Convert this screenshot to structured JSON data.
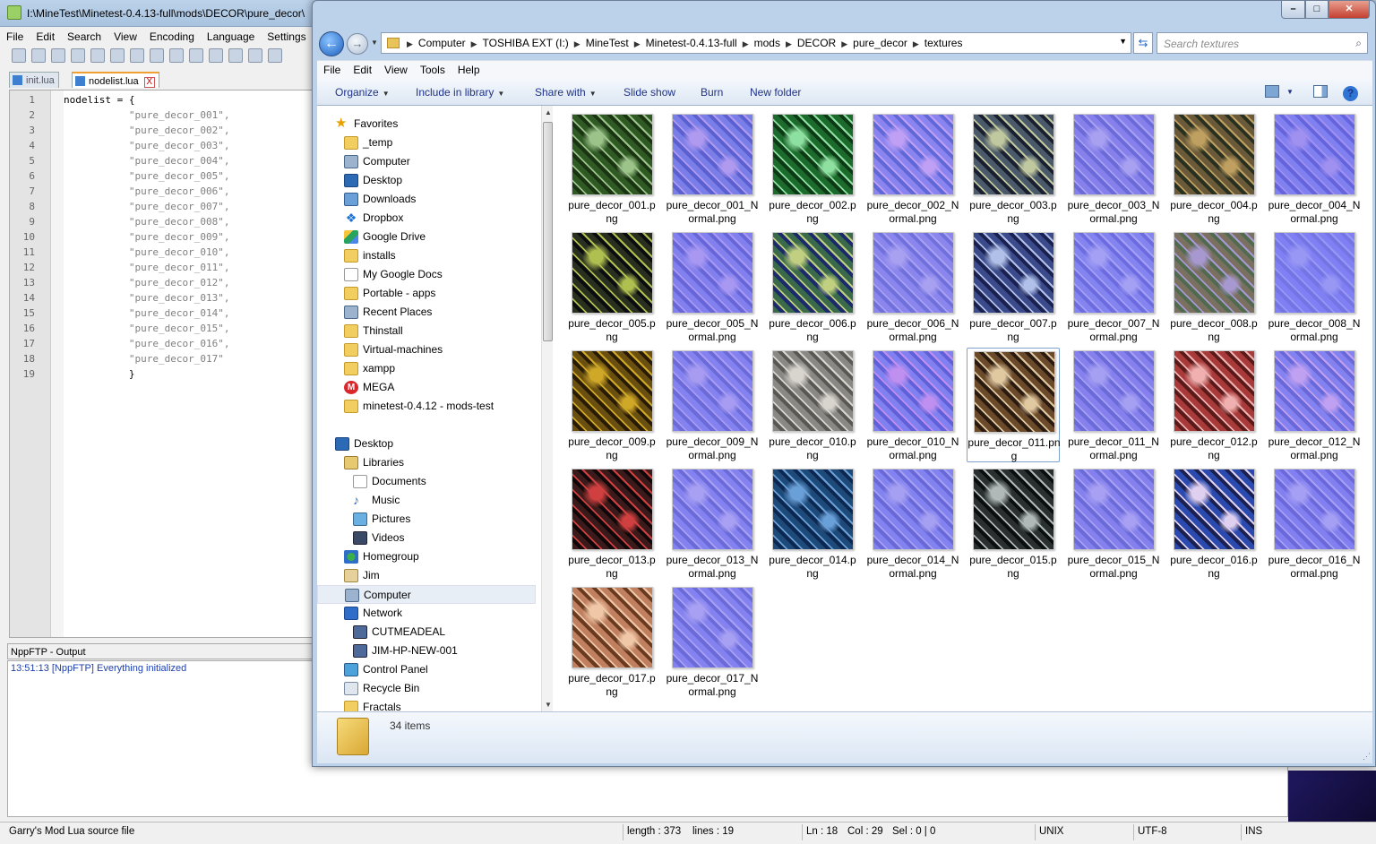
{
  "npp": {
    "title": "I:\\MineTest\\Minetest-0.4.13-full\\mods\\DECOR\\pure_decor\\",
    "menu": [
      "File",
      "Edit",
      "Search",
      "View",
      "Encoding",
      "Language",
      "Settings"
    ],
    "tabs": [
      {
        "label": "init.lua",
        "active": false
      },
      {
        "label": "nodelist.lua",
        "active": true,
        "close": "X"
      }
    ],
    "lines": [
      {
        "n": "1",
        "indent": "",
        "text": "nodelist = {"
      },
      {
        "n": "2",
        "indent": "           ",
        "text": "\"pure_decor_001\","
      },
      {
        "n": "3",
        "indent": "           ",
        "text": "\"pure_decor_002\","
      },
      {
        "n": "4",
        "indent": "           ",
        "text": "\"pure_decor_003\","
      },
      {
        "n": "5",
        "indent": "           ",
        "text": "\"pure_decor_004\","
      },
      {
        "n": "6",
        "indent": "           ",
        "text": "\"pure_decor_005\","
      },
      {
        "n": "7",
        "indent": "           ",
        "text": "\"pure_decor_006\","
      },
      {
        "n": "8",
        "indent": "           ",
        "text": "\"pure_decor_007\","
      },
      {
        "n": "9",
        "indent": "           ",
        "text": "\"pure_decor_008\","
      },
      {
        "n": "10",
        "indent": "           ",
        "text": "\"pure_decor_009\","
      },
      {
        "n": "11",
        "indent": "           ",
        "text": "\"pure_decor_010\","
      },
      {
        "n": "12",
        "indent": "           ",
        "text": "\"pure_decor_011\","
      },
      {
        "n": "13",
        "indent": "           ",
        "text": "\"pure_decor_012\","
      },
      {
        "n": "14",
        "indent": "           ",
        "text": "\"pure_decor_013\","
      },
      {
        "n": "15",
        "indent": "           ",
        "text": "\"pure_decor_014\","
      },
      {
        "n": "16",
        "indent": "           ",
        "text": "\"pure_decor_015\","
      },
      {
        "n": "17",
        "indent": "           ",
        "text": "\"pure_decor_016\","
      },
      {
        "n": "18",
        "indent": "           ",
        "text": "\"pure_decor_017\""
      },
      {
        "n": "19",
        "indent": "           ",
        "text": "}"
      }
    ],
    "output_title": "NppFTP - Output",
    "output_line": "13:51:13  [NppFTP] Everything initialized",
    "status": {
      "filetype": "Garry's Mod Lua source file",
      "length": "length : 373",
      "lines": "lines : 19",
      "ln": "Ln : 18",
      "col": "Col : 29",
      "sel": "Sel : 0 | 0",
      "eol": "UNIX",
      "enc": "UTF-8",
      "mode": "INS"
    }
  },
  "explorer": {
    "breadcrumbs": [
      "Computer",
      "TOSHIBA EXT (I:)",
      "MineTest",
      "Minetest-0.4.13-full",
      "mods",
      "DECOR",
      "pure_decor",
      "textures"
    ],
    "search_placeholder": "Search textures",
    "menu": [
      "File",
      "Edit",
      "View",
      "Tools",
      "Help"
    ],
    "commands": {
      "organize": "Organize",
      "include": "Include in library",
      "share": "Share with",
      "slideshow": "Slide show",
      "burn": "Burn",
      "newfolder": "New folder"
    },
    "nav": [
      {
        "label": "Favorites",
        "icon": "star",
        "indent": 0
      },
      {
        "label": "_temp",
        "icon": "folder",
        "indent": 1
      },
      {
        "label": "Computer",
        "icon": "comp",
        "indent": 1
      },
      {
        "label": "Desktop",
        "icon": "desk",
        "indent": 1
      },
      {
        "label": "Downloads",
        "icon": "dl",
        "indent": 1
      },
      {
        "label": "Dropbox",
        "icon": "dbx",
        "indent": 1
      },
      {
        "label": "Google Drive",
        "icon": "gd",
        "indent": 1
      },
      {
        "label": "installs",
        "icon": "folder",
        "indent": 1
      },
      {
        "label": "My Google Docs",
        "icon": "doc",
        "indent": 1
      },
      {
        "label": "Portable - apps",
        "icon": "folder",
        "indent": 1
      },
      {
        "label": "Recent Places",
        "icon": "comp",
        "indent": 1
      },
      {
        "label": "Thinstall",
        "icon": "folder",
        "indent": 1
      },
      {
        "label": "Virtual-machines",
        "icon": "folder",
        "indent": 1
      },
      {
        "label": "xampp",
        "icon": "folder",
        "indent": 1
      },
      {
        "label": "MEGA",
        "icon": "mega",
        "indent": 1
      },
      {
        "label": "minetest-0.4.12 - mods-test",
        "icon": "folder",
        "indent": 1
      },
      {
        "label": "",
        "icon": "",
        "indent": 0
      },
      {
        "label": "Desktop",
        "icon": "desk",
        "indent": 0
      },
      {
        "label": "Libraries",
        "icon": "lib",
        "indent": 1
      },
      {
        "label": "Documents",
        "icon": "doc",
        "indent": 2
      },
      {
        "label": "Music",
        "icon": "music",
        "indent": 2
      },
      {
        "label": "Pictures",
        "icon": "pic",
        "indent": 2
      },
      {
        "label": "Videos",
        "icon": "vid",
        "indent": 2
      },
      {
        "label": "Homegroup",
        "icon": "home",
        "indent": 1
      },
      {
        "label": "Jim",
        "icon": "user",
        "indent": 1
      },
      {
        "label": "Computer",
        "icon": "comp",
        "indent": 1,
        "selected": true
      },
      {
        "label": "Network",
        "icon": "net",
        "indent": 1
      },
      {
        "label": "CUTMEADEAL",
        "icon": "pc",
        "indent": 2
      },
      {
        "label": "JIM-HP-NEW-001",
        "icon": "pc",
        "indent": 2
      },
      {
        "label": "Control Panel",
        "icon": "cp",
        "indent": 1
      },
      {
        "label": "Recycle Bin",
        "icon": "bin",
        "indent": 1
      },
      {
        "label": "Fractals",
        "icon": "folder",
        "indent": 1
      }
    ],
    "files": [
      {
        "name": "pure_decor_001.png",
        "tex": [
          "#2f5a24",
          "#9cc48a",
          "#1a3312"
        ]
      },
      {
        "name": "pure_decor_001_Normal.png",
        "tex": [
          "#7a7ee8",
          "#b09af0",
          "#5a60d0"
        ]
      },
      {
        "name": "pure_decor_002.png",
        "tex": [
          "#1c6a2c",
          "#8ee0a0",
          "#0c3a16"
        ]
      },
      {
        "name": "pure_decor_002_Normal.png",
        "tex": [
          "#8a84f0",
          "#c0a0f4",
          "#6068d8"
        ]
      },
      {
        "name": "pure_decor_003.png",
        "tex": [
          "#4a5a6a",
          "#c0c8a0",
          "#1a2030"
        ]
      },
      {
        "name": "pure_decor_003_Normal.png",
        "tex": [
          "#8680ec",
          "#a8a0f0",
          "#6a6ad8"
        ]
      },
      {
        "name": "pure_decor_004.png",
        "tex": [
          "#6a5a3a",
          "#c0a060",
          "#2a3020"
        ]
      },
      {
        "name": "pure_decor_004_Normal.png",
        "tex": [
          "#8080f0",
          "#a090f0",
          "#6464dc"
        ]
      },
      {
        "name": "pure_decor_005.png",
        "tex": [
          "#2a3020",
          "#b0c050",
          "#0a0c10"
        ]
      },
      {
        "name": "pure_decor_005_Normal.png",
        "tex": [
          "#8280ee",
          "#a898f2",
          "#6666d8"
        ]
      },
      {
        "name": "pure_decor_006.png",
        "tex": [
          "#3a6a4a",
          "#c0d080",
          "#1a2a6a"
        ]
      },
      {
        "name": "pure_decor_006_Normal.png",
        "tex": [
          "#8a86ee",
          "#a8a0f0",
          "#7070dc"
        ]
      },
      {
        "name": "pure_decor_007.png",
        "tex": [
          "#3a4a8a",
          "#b0c0e8",
          "#1a2050"
        ]
      },
      {
        "name": "pure_decor_007_Normal.png",
        "tex": [
          "#8484f0",
          "#a4a0f4",
          "#6c6ce0"
        ]
      },
      {
        "name": "pure_decor_008.png",
        "tex": [
          "#7a7060",
          "#a898d0",
          "#506a50"
        ]
      },
      {
        "name": "pure_decor_008_Normal.png",
        "tex": [
          "#8080f4",
          "#9898f4",
          "#7474e4"
        ]
      },
      {
        "name": "pure_decor_009.png",
        "tex": [
          "#6a5010",
          "#d0a828",
          "#2a1c04"
        ]
      },
      {
        "name": "pure_decor_009_Normal.png",
        "tex": [
          "#8482f0",
          "#a89cf2",
          "#6a6ad8"
        ]
      },
      {
        "name": "pure_decor_010.png",
        "tex": [
          "#8a8884",
          "#d8d4ce",
          "#5a5854"
        ]
      },
      {
        "name": "pure_decor_010_Normal.png",
        "tex": [
          "#8080f0",
          "#c090f0",
          "#6060d8"
        ]
      },
      {
        "name": "pure_decor_011.png",
        "tex": [
          "#6a4a2a",
          "#e0c8a0",
          "#2a1a10"
        ]
      },
      {
        "name": "pure_decor_011_Normal.png",
        "tex": [
          "#8680ee",
          "#a6a0f2",
          "#6a6ad8"
        ]
      },
      {
        "name": "pure_decor_012.png",
        "tex": [
          "#a83a3a",
          "#f0b0b0",
          "#5a1a1a"
        ]
      },
      {
        "name": "pure_decor_012_Normal.png",
        "tex": [
          "#8482f0",
          "#c0a0f0",
          "#6868d8"
        ]
      },
      {
        "name": "pure_decor_013.png",
        "tex": [
          "#3a1a1a",
          "#d04040",
          "#100808"
        ]
      },
      {
        "name": "pure_decor_013_Normal.png",
        "tex": [
          "#8482f0",
          "#a8a0f2",
          "#6a6ad8"
        ]
      },
      {
        "name": "pure_decor_014.png",
        "tex": [
          "#1e4a7a",
          "#6aa0d8",
          "#0c2850"
        ]
      },
      {
        "name": "pure_decor_014_Normal.png",
        "tex": [
          "#8282f0",
          "#a6a0f2",
          "#6868d8"
        ]
      },
      {
        "name": "pure_decor_015.png",
        "tex": [
          "#2a3030",
          "#b0b8b8",
          "#0a0e0e"
        ]
      },
      {
        "name": "pure_decor_015_Normal.png",
        "tex": [
          "#8480ee",
          "#a8a0f2",
          "#6a6ad8"
        ]
      },
      {
        "name": "pure_decor_016.png",
        "tex": [
          "#2a4ab0",
          "#e0d0f0",
          "#1a2050"
        ]
      },
      {
        "name": "pure_decor_016_Normal.png",
        "tex": [
          "#8280f0",
          "#a6a0f4",
          "#6a68da"
        ]
      },
      {
        "name": "pure_decor_017.png",
        "tex": [
          "#c08060",
          "#f0c8a8",
          "#6a3a20"
        ]
      },
      {
        "name": "pure_decor_017_Normal.png",
        "tex": [
          "#8482f0",
          "#a8a0f2",
          "#6a6ad8"
        ]
      }
    ],
    "item_count": "34 items"
  }
}
